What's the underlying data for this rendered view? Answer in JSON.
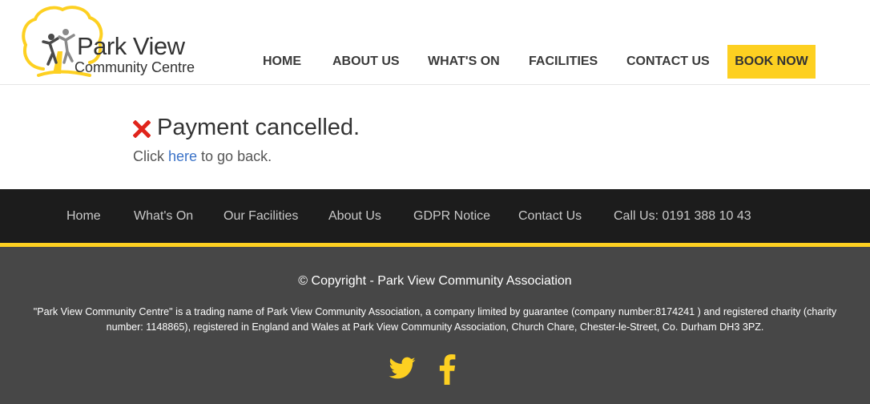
{
  "header": {
    "logo_title": "Park View",
    "logo_subtitle": "Community Centre",
    "nav": [
      {
        "label": "HOME"
      },
      {
        "label": "ABOUT US"
      },
      {
        "label": "WHAT'S ON"
      },
      {
        "label": "FACILITIES"
      },
      {
        "label": "CONTACT US"
      }
    ],
    "book_label": "BOOK NOW"
  },
  "main": {
    "title": "Payment cancelled.",
    "back_prefix": "Click ",
    "back_link": "here",
    "back_suffix": " to go back.",
    "icon": "cross-icon"
  },
  "footer_nav": [
    {
      "label": "Home"
    },
    {
      "label": "What's On"
    },
    {
      "label": "Our Facilities"
    },
    {
      "label": "About Us"
    },
    {
      "label": "GDPR Notice"
    },
    {
      "label": "Contact Us"
    },
    {
      "label": "Call Us: 0191 388 10 43"
    }
  ],
  "footer": {
    "copyright": "© Copyright - Park View Community Association",
    "legal": "\"Park View Community Centre\" is a trading name of Park View Community Association, a company limited by guarantee (company number:8174241 ) and registered charity (charity number: 1148865), registered in England and Wales at Park View Community Association, Church Chare, Chester-le-Street, Co. Durham DH3 3PZ.",
    "social": [
      "twitter-icon",
      "facebook-icon"
    ]
  },
  "colors": {
    "accent": "#fdd021",
    "footer_dark": "#1c1c1c",
    "footer_grey": "#474747",
    "link": "#3b73c8",
    "cancel_red": "#e0241b"
  }
}
